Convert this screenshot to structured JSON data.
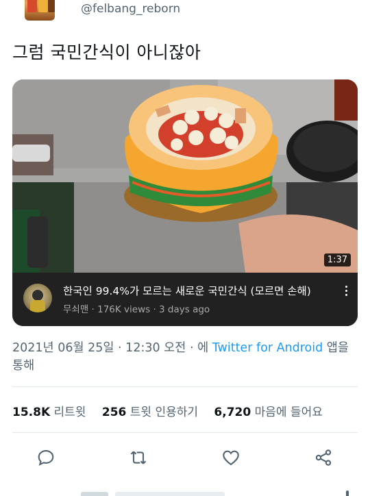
{
  "user": {
    "handle": "@felbang_reborn"
  },
  "tweet": {
    "text": "그럼 국민간식이 아니잖아"
  },
  "video_card": {
    "duration": "1:37",
    "title": "한국인 99.4%가 모르는 새로운 국민간식 (모르면 손해)",
    "channel_meta": "무쇠맨 · 176K views · 3 days ago",
    "more_icon": "more-vertical-icon"
  },
  "meta": {
    "timestamp": "2021년 06월 25일 · 12:30 오전 · 에 ",
    "source_link": "Twitter for Android",
    "suffix": " 앱을 통해"
  },
  "stats": {
    "retweets_count": "15.8K",
    "retweets_label": "리트윗",
    "quotes_count": "256",
    "quotes_label": "트윗 인용하기",
    "likes_count": "6,720",
    "likes_label": "마음에 들어요"
  },
  "actions": [
    {
      "icon": "reply-icon"
    },
    {
      "icon": "retweet-icon"
    },
    {
      "icon": "like-icon"
    },
    {
      "icon": "share-icon"
    }
  ],
  "colors": {
    "link": "#1d9bf0",
    "secondary_text": "#536471",
    "card_footer": "#212121"
  }
}
